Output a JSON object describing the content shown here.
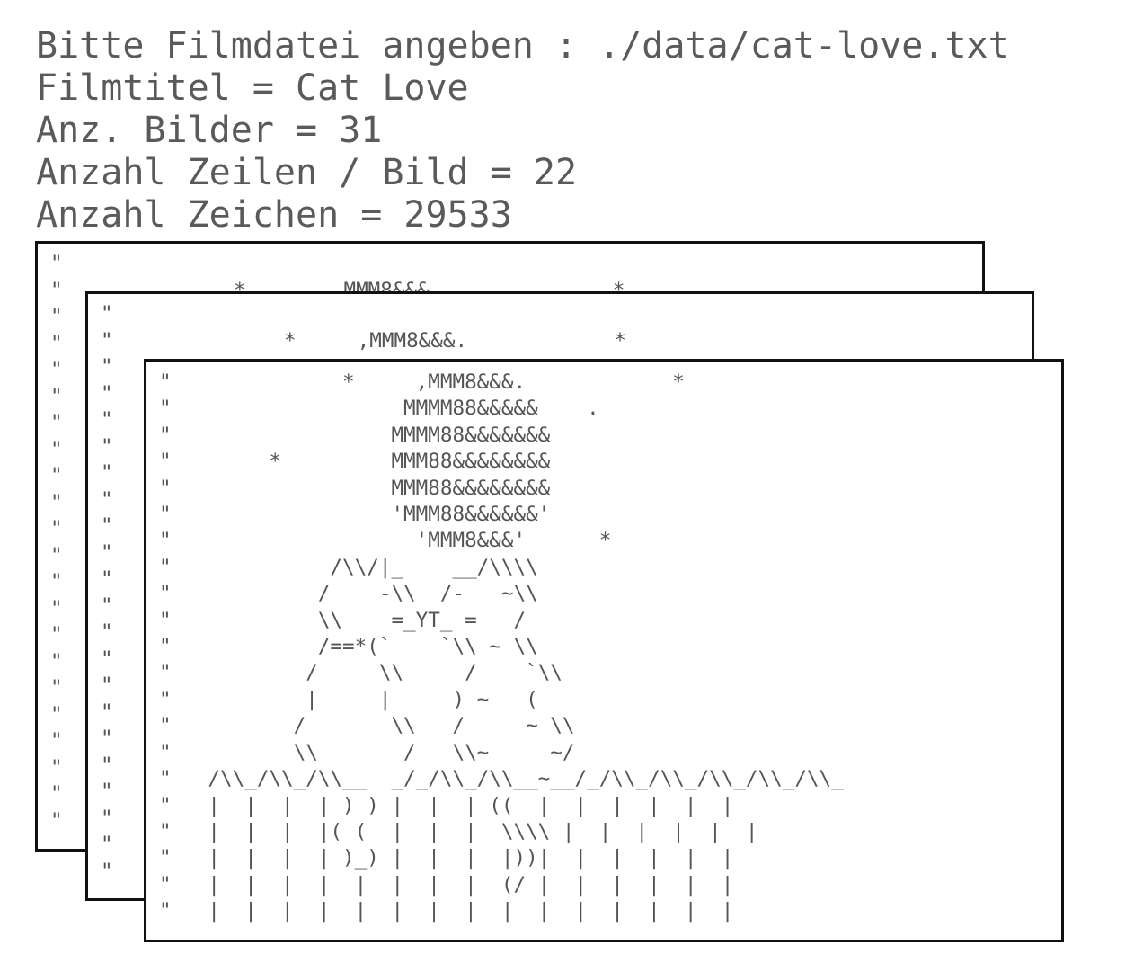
{
  "console": {
    "prompt_line": "Bitte Filmdatei angeben : ./data/cat-love.txt",
    "title_line": "Filmtitel = Cat Love",
    "frames_line": "Anz. Bilder = 31",
    "rows_line": "Anzahl Zeilen / Bild = 22",
    "chars_line": "Anzahl Zeichen = 29533"
  },
  "frames": {
    "back": "\"\n\"              *        MMM8&&&               *\n\"\n\"\n\"\n\"\n\"\n\"\n\"\n\"\n\"\n\"\n\"\n\"\n\"\n\"\n\"\n\"\n\"\n\"\n\"\n\"",
    "middle": "\"\n\"              *     ,MMM8&&&.            *\n\"\n\"\n\"\n\"\n\"\n\"\n\"\n\"\n\"\n\"\n\"\n\"\n\"\n\"\n\"\n\"\n\"\n\"\n\"\n\"",
    "front": "\"              *     ,MMM8&&&.            *\n\"                   MMMM88&&&&&    .\n\"                  MMMM88&&&&&&&\n\"        *         MMM88&&&&&&&&\n\"                  MMM88&&&&&&&&\n\"                  'MMM88&&&&&&'\n\"                    'MMM8&&&'      *\n\"             /\\\\/|_    __/\\\\\\\\\n\"            /    -\\\\  /-   ~\\\\\n\"            \\\\    =_YT_ =   /\n\"            /==*(`    `\\\\ ~ \\\\\n\"           /     \\\\     /    `\\\\\n\"           |     |     ) ~   (\n\"          /       \\\\   /     ~ \\\\\n\"          \\\\       /   \\\\~     ~/\n\"   /\\\\_/\\\\_/\\\\__  _/_/\\\\_/\\\\__~__/_/\\\\_/\\\\_/\\\\_/\\\\_/\\\\_\n\"   |  |  |  | ) ) |  |  | ((  |  |  |  |  |  |\n\"   |  |  |  |( (  |  |  |  \\\\\\\\ |  |  |  |  |  |\n\"   |  |  |  | )_) |  |  |  |))|  |  |  |  |  |\n\"   |  |  |  |  |  |  |  |  (/ |  |  |  |  |  |\n\"   |  |  |  |  |  |  |  |  |  |  |  |  |  |  |"
  }
}
